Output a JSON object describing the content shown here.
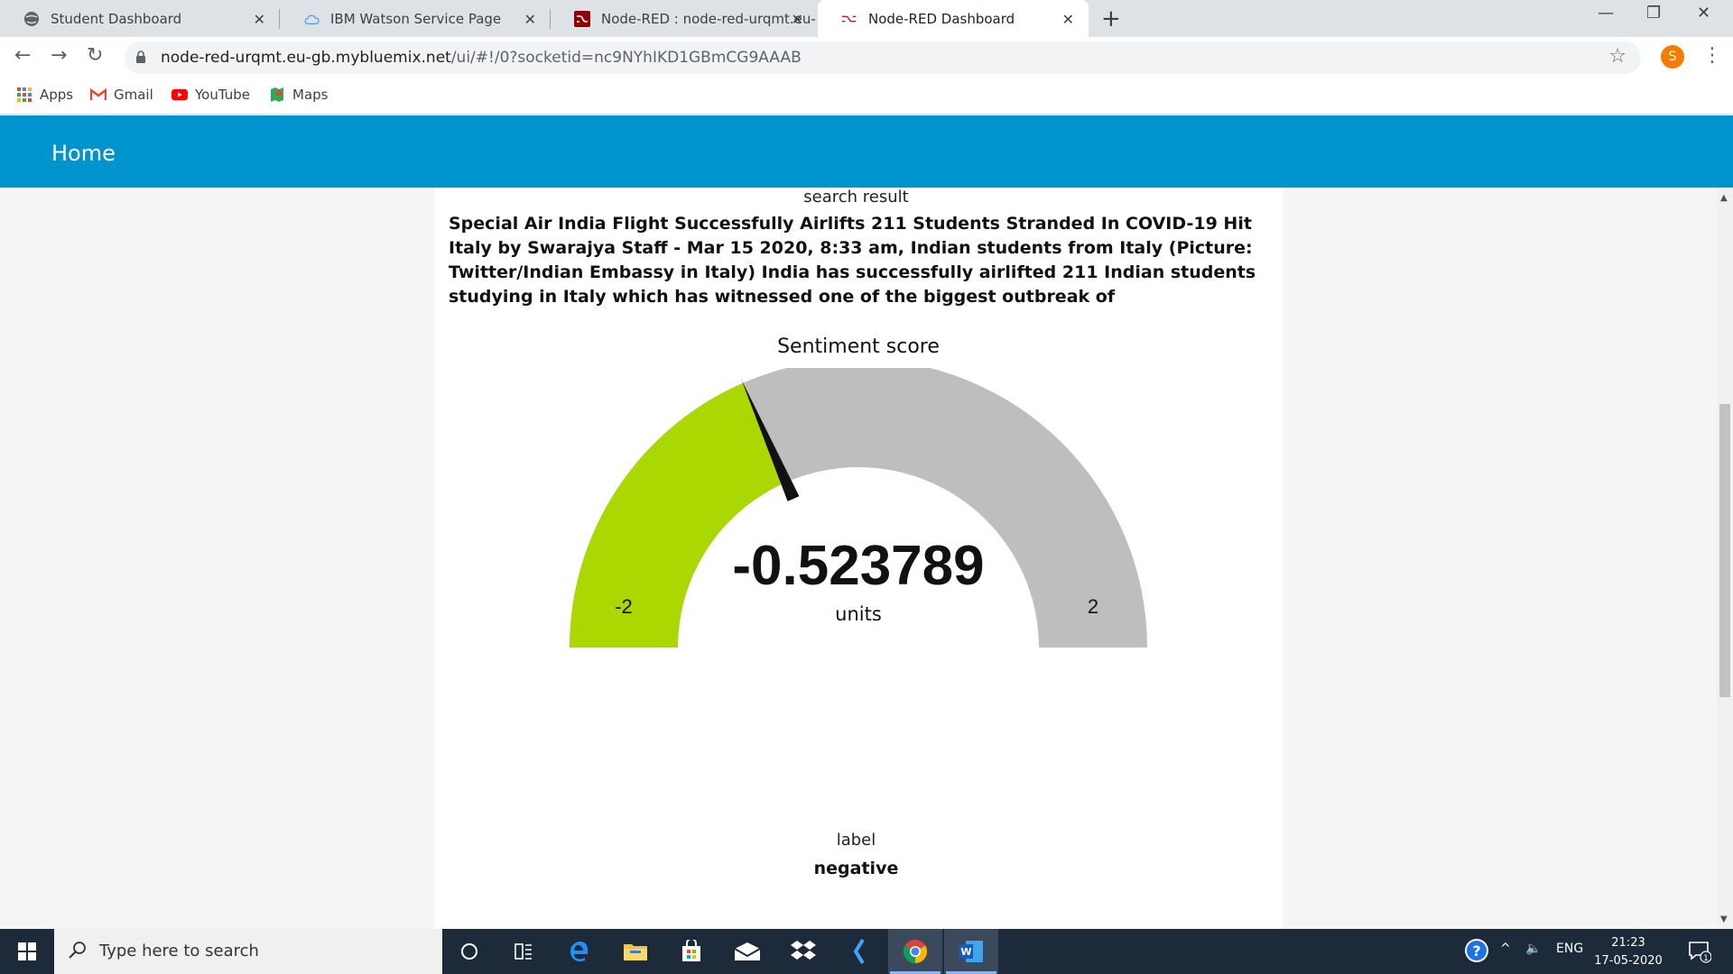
{
  "browser": {
    "tabs": [
      {
        "title": "Student Dashboard",
        "icon": "globe-icon"
      },
      {
        "title": "IBM Watson Service Page",
        "icon": "cloud-icon"
      },
      {
        "title": "Node-RED : node-red-urqmt.eu-",
        "icon": "node-red-icon"
      },
      {
        "title": "Node-RED Dashboard",
        "icon": "node-red-icon"
      }
    ],
    "url_host": "node-red-urqmt.eu-gb.mybluemix.net",
    "url_rest": "/ui/#!/0?socketid=nc9NYhIKD1GBmCG9AAAB",
    "profile_initial": "S",
    "bookmarks": [
      {
        "label": "Apps",
        "icon": "apps-grid-icon"
      },
      {
        "label": "Gmail",
        "icon": "gmail-icon"
      },
      {
        "label": "YouTube",
        "icon": "youtube-icon"
      },
      {
        "label": "Maps",
        "icon": "maps-icon"
      }
    ]
  },
  "dashboard": {
    "header_title": "Home",
    "search_result": {
      "label": "search result",
      "text": "Special Air India Flight Successfully Airlifts 211 Students Stranded In COVID-19 Hit Italy by Swarajya Staff - Mar 15 2020, 8:33 am, Indian students from Italy (Picture: Twitter/Indian Embassy in Italy) India has successfully airlifted 211 Indian students studying in Italy which has witnessed one of the biggest outbreak of"
    },
    "gauge": {
      "title": "Sentiment score",
      "value": -0.523789,
      "value_text": "-0.523789",
      "units": "units",
      "min": -2,
      "max": 2,
      "min_text": "-2",
      "max_text": "2",
      "fill_color": "#aad800",
      "track_color": "#bebebe"
    },
    "label_widget": {
      "label": "label",
      "value": "negative"
    }
  },
  "taskbar": {
    "search_placeholder": "Type here to search",
    "tray_lang": "ENG",
    "time": "21:23",
    "date": "17-05-2020",
    "notification_count": "1"
  }
}
